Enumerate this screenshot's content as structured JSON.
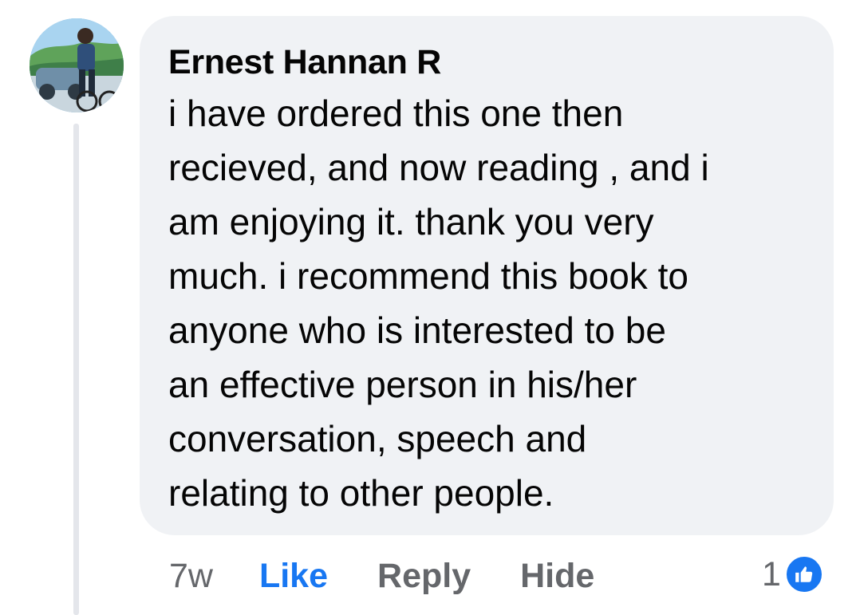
{
  "comment": {
    "author": "Ernest Hannan R",
    "text": "i have ordered this one then\nrecieved, and now reading , and i\nam enjoying it. thank you very\nmuch. i recommend this book to\nanyone who is interested to be\nan effective person in his/her\nconversation, speech and\nrelating to other people."
  },
  "actions": {
    "time": "7w",
    "like_label": "Like",
    "reply_label": "Reply",
    "hide_label": "Hide"
  },
  "reactions": {
    "count": "1",
    "icon": "thumbs-up-icon"
  },
  "colors": {
    "accent": "#1877f2",
    "bubble": "#f0f2f5",
    "muted_text": "#65676b",
    "text": "#050505"
  }
}
